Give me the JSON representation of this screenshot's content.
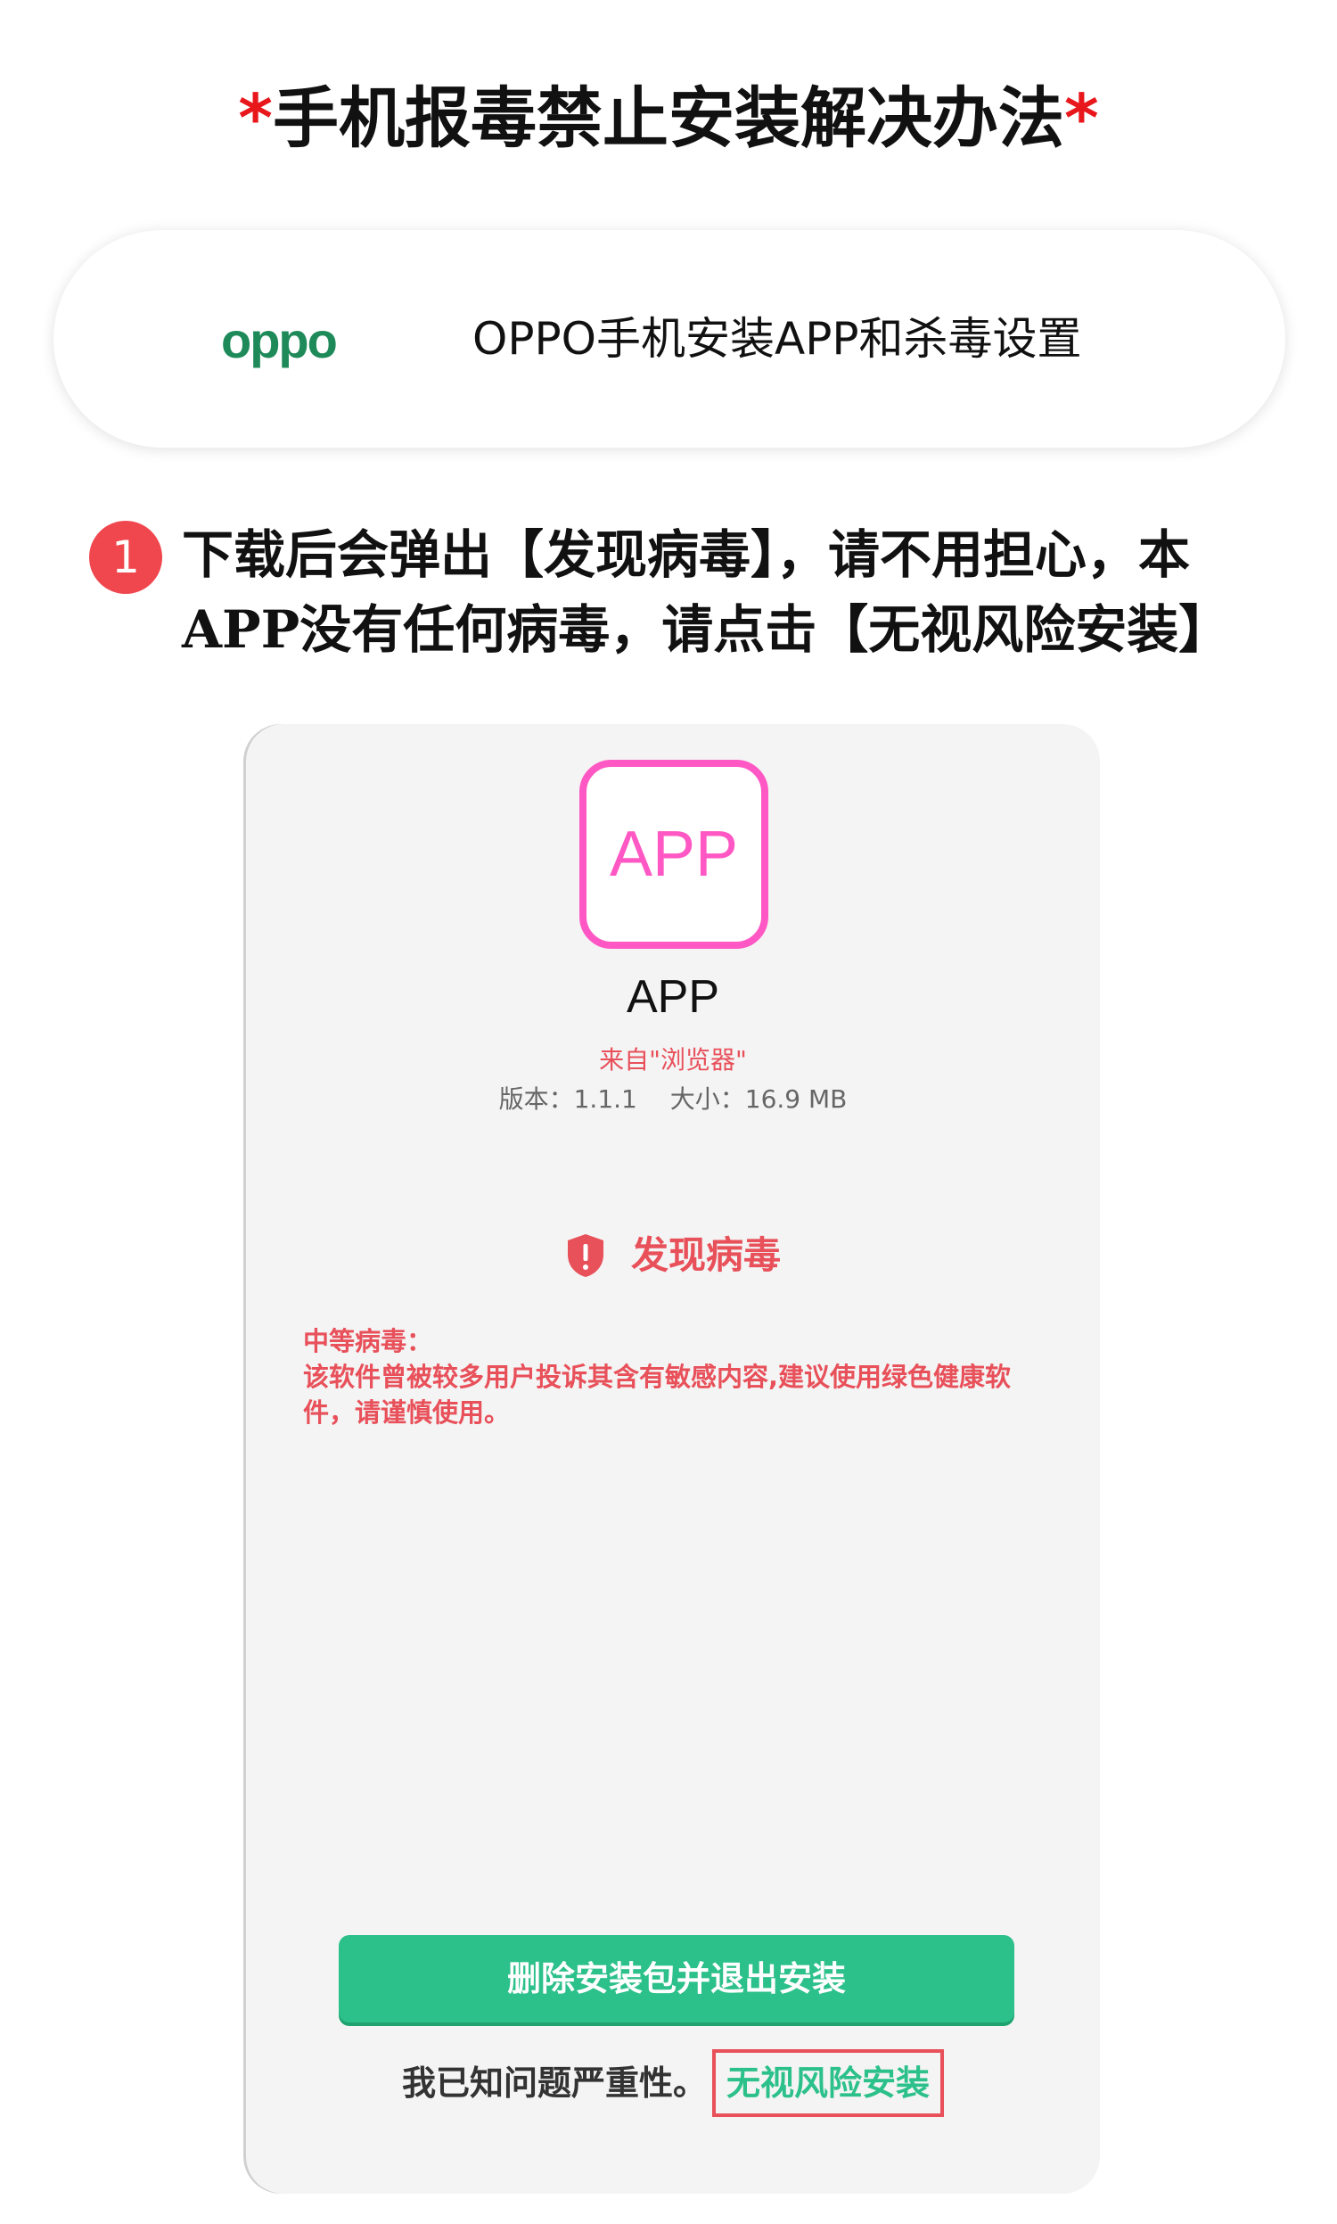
{
  "page": {
    "title_star_left": "*",
    "title": "手机报毒禁止安装解决办法",
    "title_star_right": "*"
  },
  "brand": {
    "logo_text": "oppo",
    "text": "OPPO手机安装APP和杀毒设置"
  },
  "step": {
    "number": "1",
    "text": "下载后会弹出【发现病毒】，请不用担心，本APP没有任何病毒，请点击【无视风险安装】"
  },
  "dialog": {
    "icon_text": "APP",
    "app_name": "APP",
    "source": "来自\"浏览器\"",
    "version": "版本：1.1.1",
    "size": "大小：16.9 MB",
    "virus_title": "发现病毒",
    "warning_level": "中等病毒：",
    "warning_text": "该软件曾被较多用户投诉其含有敏感内容,建议使用绿色健康软件，请谨慎使用。",
    "delete_button": "删除安装包并退出安装",
    "ack_text": "我已知问题严重性。",
    "ignore_button": "无视风险安装"
  },
  "colors": {
    "accent_red": "#e8171c",
    "badge_red": "#f0464e",
    "app_pink": "#ff58c4",
    "green": "#2cc08a",
    "oppo_green": "#1e8a5a"
  }
}
